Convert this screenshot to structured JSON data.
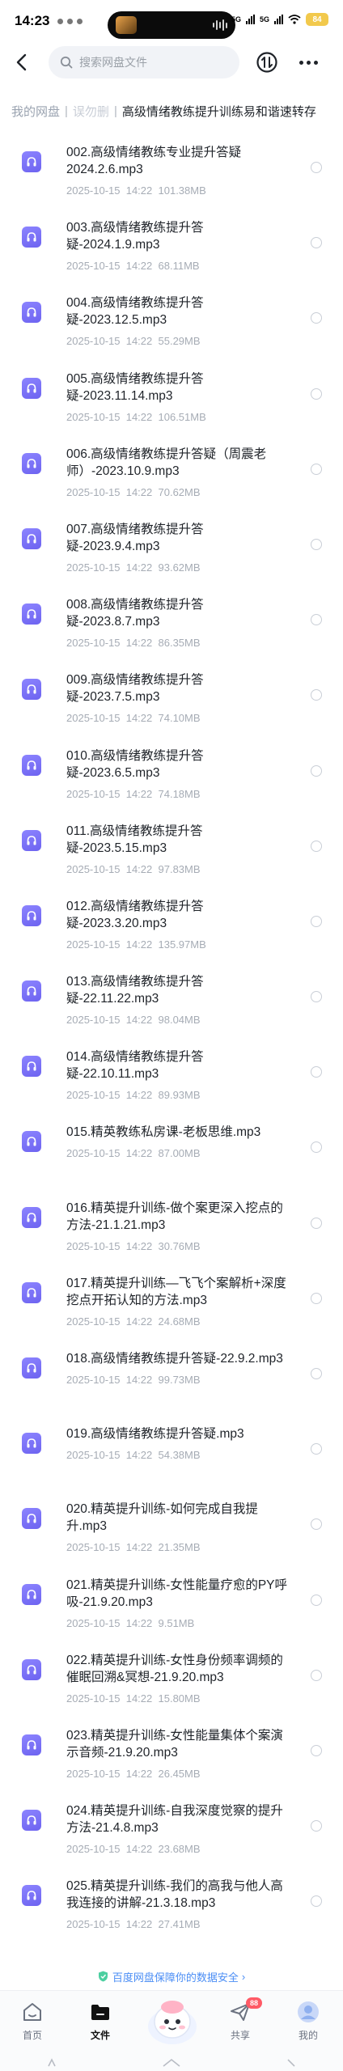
{
  "status_bar": {
    "time": "14:23",
    "network_left": "5G",
    "network_right": "5G",
    "battery": "84"
  },
  "nav": {
    "search_placeholder": "搜索网盘文件",
    "icons": [
      "back-icon",
      "search-icon",
      "sort-icon",
      "more-icon"
    ]
  },
  "breadcrumb": {
    "items": [
      "我的网盘",
      "误勿删",
      "高级情绪教练提升训练易和谐速转存"
    ]
  },
  "files": [
    {
      "name": "002.高级情绪教练专业提升答疑2024.2.6.mp3",
      "date": "2025-10-15  14:22",
      "size": "101.38MB"
    },
    {
      "name": "003.高级情绪教练提升答疑-2024.1.9.mp3",
      "date": "2025-10-15  14:22",
      "size": "68.11MB"
    },
    {
      "name": "004.高级情绪教练提升答疑-2023.12.5.mp3",
      "date": "2025-10-15  14:22",
      "size": "55.29MB"
    },
    {
      "name": "005.高级情绪教练提升答疑-2023.11.14.mp3",
      "date": "2025-10-15  14:22",
      "size": "106.51MB"
    },
    {
      "name": "006.高级情绪教练提升答疑（周震老师）-2023.10.9.mp3",
      "date": "2025-10-15  14:22",
      "size": "70.62MB"
    },
    {
      "name": "007.高级情绪教练提升答疑-2023.9.4.mp3",
      "date": "2025-10-15  14:22",
      "size": "93.62MB"
    },
    {
      "name": "008.高级情绪教练提升答疑-2023.8.7.mp3",
      "date": "2025-10-15  14:22",
      "size": "86.35MB"
    },
    {
      "name": "009.高级情绪教练提升答疑-2023.7.5.mp3",
      "date": "2025-10-15  14:22",
      "size": "74.10MB"
    },
    {
      "name": "010.高级情绪教练提升答疑-2023.6.5.mp3",
      "date": "2025-10-15  14:22",
      "size": "74.18MB"
    },
    {
      "name": "011.高级情绪教练提升答疑-2023.5.15.mp3",
      "date": "2025-10-15  14:22",
      "size": "97.83MB"
    },
    {
      "name": "012.高级情绪教练提升答疑-2023.3.20.mp3",
      "date": "2025-10-15  14:22",
      "size": "135.97MB"
    },
    {
      "name": "013.高级情绪教练提升答疑-22.11.22.mp3",
      "date": "2025-10-15  14:22",
      "size": "98.04MB"
    },
    {
      "name": "014.高级情绪教练提升答疑-22.10.11.mp3",
      "date": "2025-10-15  14:22",
      "size": "89.93MB"
    },
    {
      "name": "015.精英教练私房课-老板思维.mp3",
      "date": "2025-10-15  14:22",
      "size": "87.00MB"
    },
    {
      "name": "016.精英提升训练-做个案更深入挖点的方法-21.1.21.mp3",
      "date": "2025-10-15  14:22",
      "size": "30.76MB"
    },
    {
      "name": "017.精英提升训练—飞飞个案解析+深度挖点开拓认知的方法.mp3",
      "date": "2025-10-15  14:22",
      "size": "24.68MB"
    },
    {
      "name": "018.高级情绪教练提升答疑-22.9.2.mp3",
      "date": "2025-10-15  14:22",
      "size": "99.73MB"
    },
    {
      "name": "019.高级情绪教练提升答疑.mp3",
      "date": "2025-10-15  14:22",
      "size": "54.38MB"
    },
    {
      "name": "020.精英提升训练-如何完成自我提升.mp3",
      "date": "2025-10-15  14:22",
      "size": "21.35MB"
    },
    {
      "name": "021.精英提升训练-女性能量疗愈的PY呼吸-21.9.20.mp3",
      "date": "2025-10-15  14:22",
      "size": "9.51MB"
    },
    {
      "name": "022.精英提升训练-女性身份频率调频的催眠回溯&冥想-21.9.20.mp3",
      "date": "2025-10-15  14:22",
      "size": "15.80MB"
    },
    {
      "name": "023.精英提升训练-女性能量集体个案演示音频-21.9.20.mp3",
      "date": "2025-10-15  14:22",
      "size": "26.45MB"
    },
    {
      "name": "024.精英提升训练-自我深度觉察的提升方法-21.4.8.mp3",
      "date": "2025-10-15  14:22",
      "size": "23.68MB"
    },
    {
      "name": "025.精英提升训练-我们的高我与他人高我连接的讲解-21.3.18.mp3",
      "date": "2025-10-15  14:22",
      "size": "27.41MB"
    }
  ],
  "security_note": "百度网盘保障你的数据安全",
  "tabs": [
    {
      "label": "首页",
      "icon": "home-icon"
    },
    {
      "label": "文件",
      "icon": "folder-icon"
    },
    {
      "label": "共享",
      "icon": "share-icon",
      "badge": "88"
    },
    {
      "label": "我的",
      "icon": "profile-icon"
    }
  ],
  "colors": {
    "accent": "#6d63f0",
    "link": "#4a8df5",
    "badge": "#ff5a66",
    "battery": "#f2c94c"
  }
}
